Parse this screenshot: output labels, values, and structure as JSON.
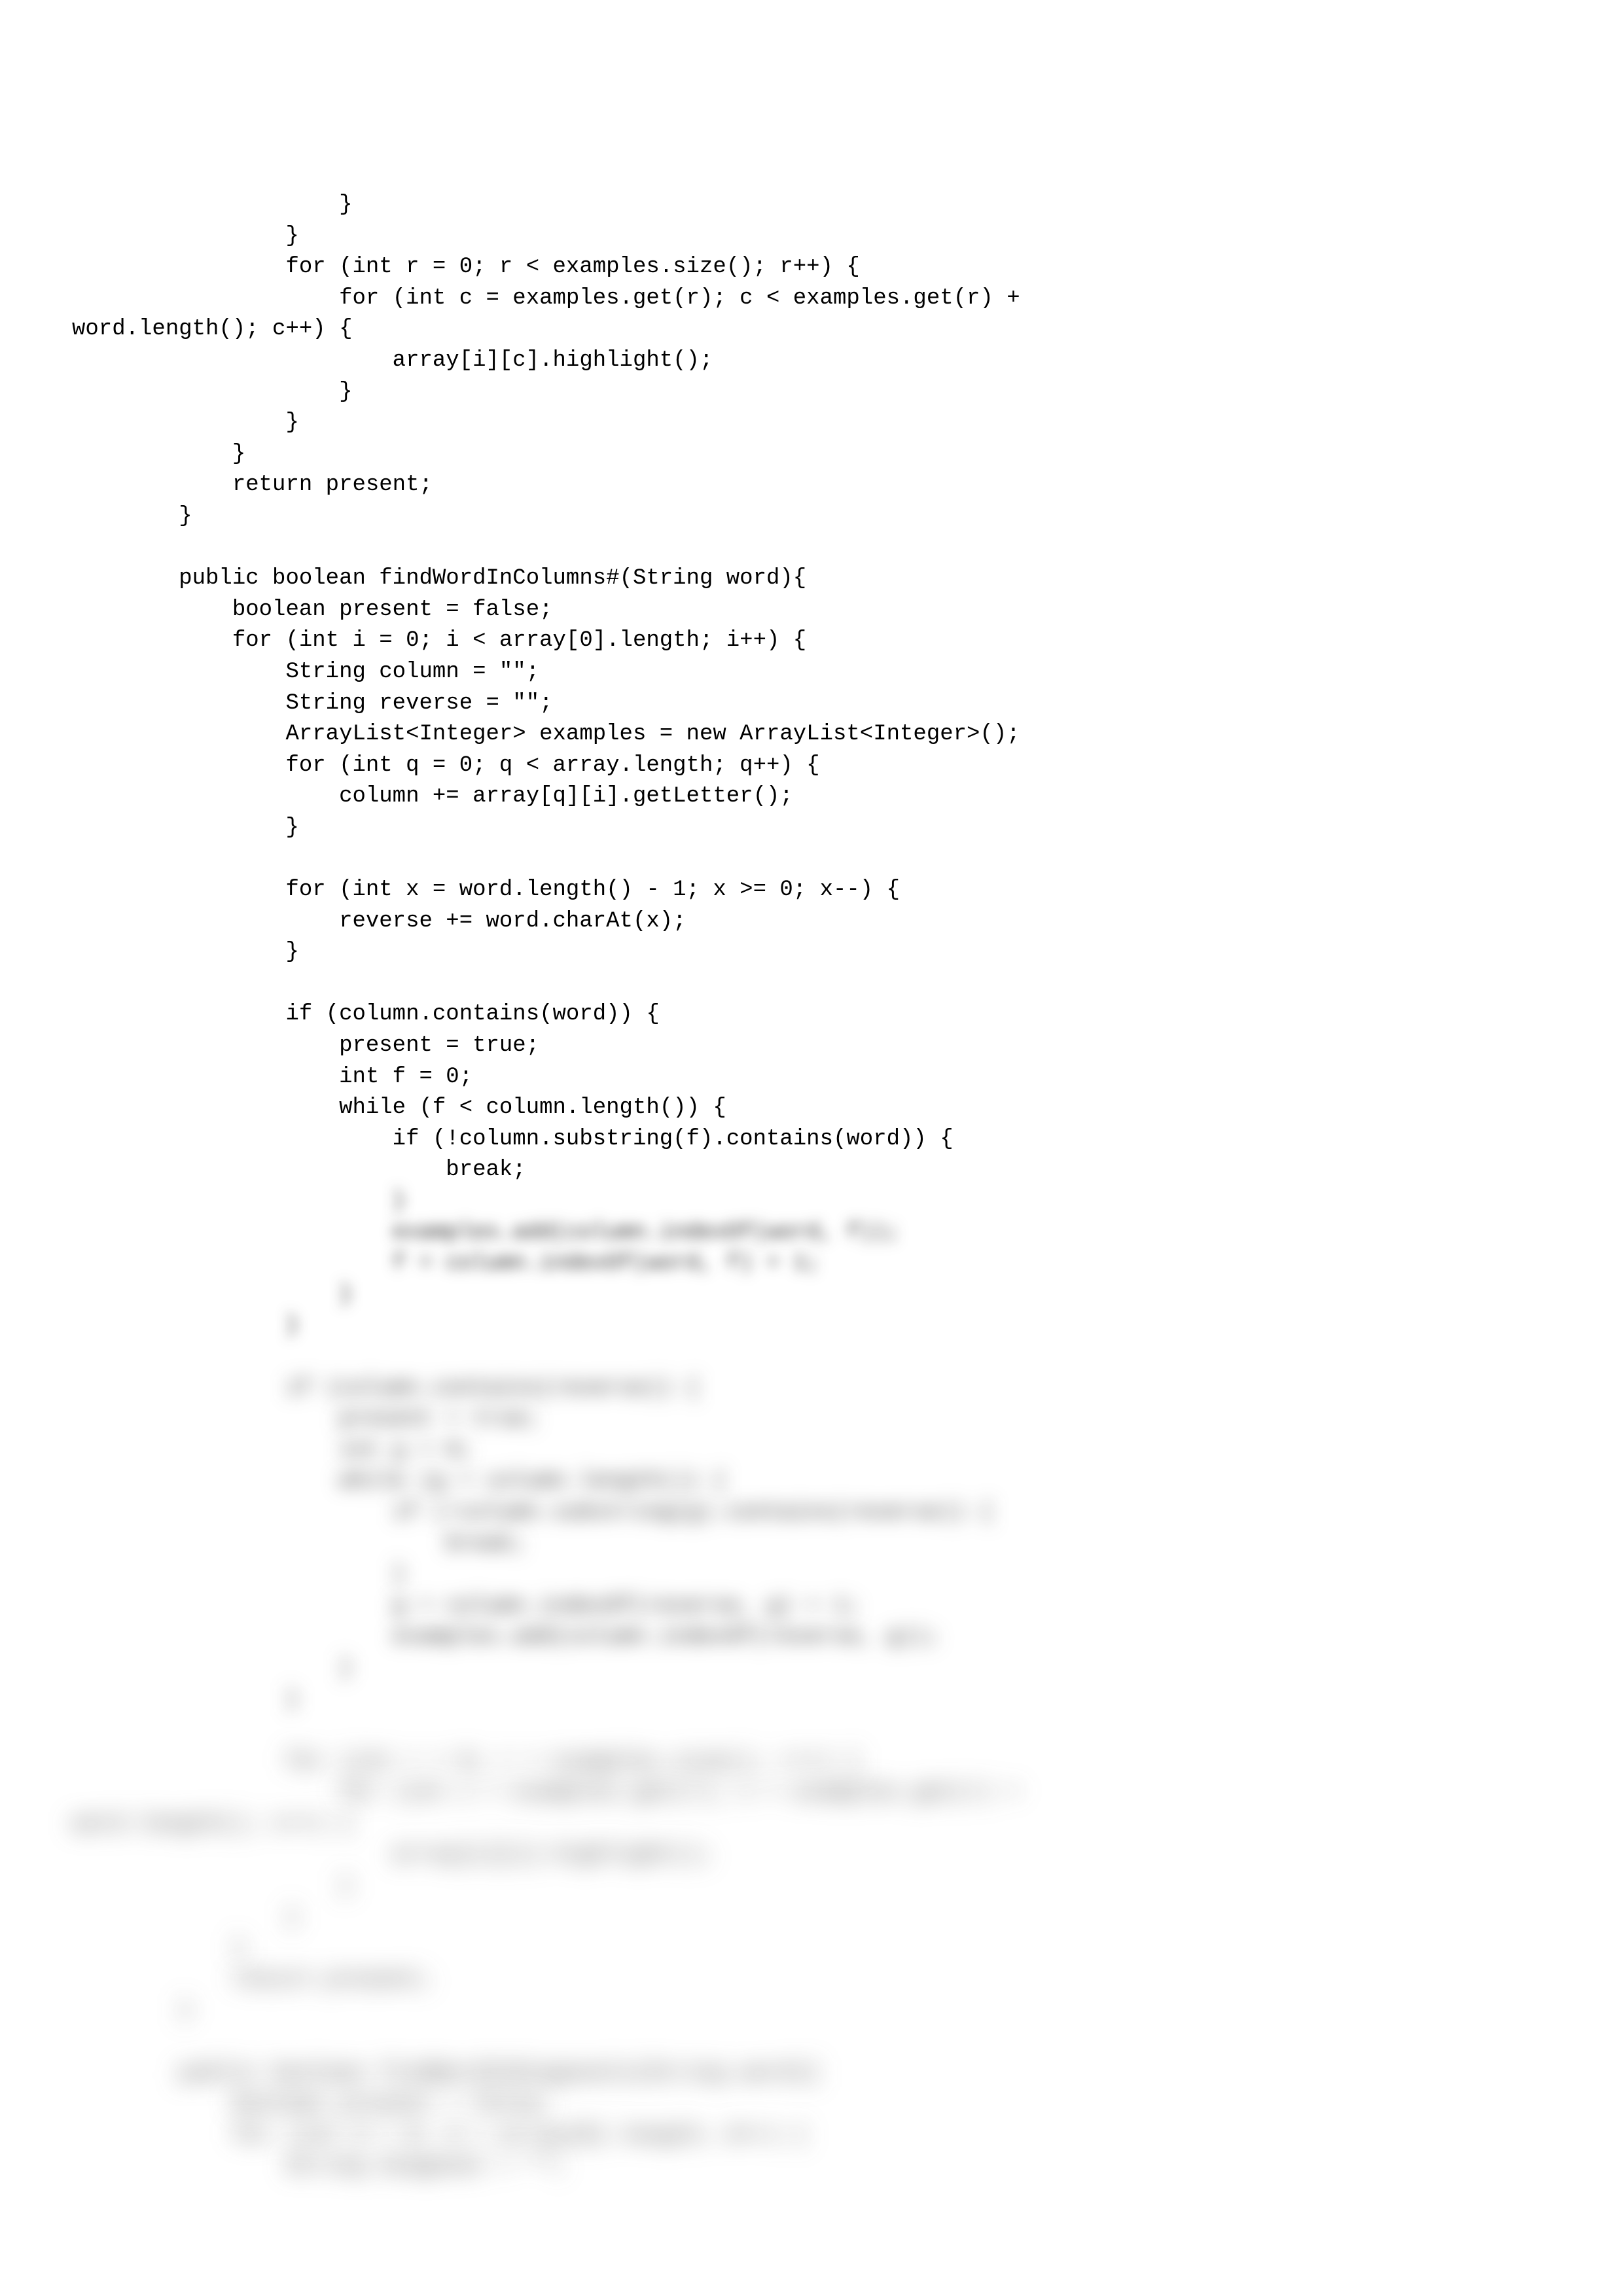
{
  "lines": [
    {
      "text": "                    }",
      "cls": ""
    },
    {
      "text": "                }",
      "cls": ""
    },
    {
      "text": "                for (int r = 0; r < examples.size(); r++) {",
      "cls": ""
    },
    {
      "text": "                    for (int c = examples.get(r); c < examples.get(r) +",
      "cls": ""
    },
    {
      "text": "word.length(); c++) {",
      "cls": ""
    },
    {
      "text": "                        array[i][c].highlight();",
      "cls": ""
    },
    {
      "text": "                    }",
      "cls": ""
    },
    {
      "text": "                }",
      "cls": ""
    },
    {
      "text": "            }",
      "cls": ""
    },
    {
      "text": "            return present;",
      "cls": ""
    },
    {
      "text": "        }",
      "cls": ""
    },
    {
      "text": "",
      "cls": ""
    },
    {
      "text": "        public boolean findWordInColumns#(String word){",
      "cls": ""
    },
    {
      "text": "            boolean present = false;",
      "cls": ""
    },
    {
      "text": "            for (int i = 0; i < array[0].length; i++) {",
      "cls": ""
    },
    {
      "text": "                String column = \"\";",
      "cls": ""
    },
    {
      "text": "                String reverse = \"\";",
      "cls": ""
    },
    {
      "text": "                ArrayList<Integer> examples = new ArrayList<Integer>();",
      "cls": ""
    },
    {
      "text": "                for (int q = 0; q < array.length; q++) {",
      "cls": ""
    },
    {
      "text": "                    column += array[q][i].getLetter();",
      "cls": ""
    },
    {
      "text": "                }",
      "cls": ""
    },
    {
      "text": "",
      "cls": ""
    },
    {
      "text": "                for (int x = word.length() - 1; x >= 0; x--) {",
      "cls": ""
    },
    {
      "text": "                    reverse += word.charAt(x);",
      "cls": ""
    },
    {
      "text": "                }",
      "cls": ""
    },
    {
      "text": "",
      "cls": ""
    },
    {
      "text": "                if (column.contains(word)) {",
      "cls": ""
    },
    {
      "text": "                    present = true;",
      "cls": ""
    },
    {
      "text": "                    int f = 0;",
      "cls": ""
    },
    {
      "text": "                    while (f < column.length()) {",
      "cls": ""
    },
    {
      "text": "                        if (!column.substring(f).contains(word)) {",
      "cls": ""
    },
    {
      "text": "                            break;",
      "cls": ""
    },
    {
      "text": "                        }",
      "cls": "blur-start"
    },
    {
      "text": "                        examples.add(column.indexOf(word, f));",
      "cls": "blur-start"
    },
    {
      "text": "                        f = column.indexOf(word, f) + 1;",
      "cls": "blur-start"
    },
    {
      "text": "                    }",
      "cls": "blur-start"
    },
    {
      "text": "                }",
      "cls": "blur-start"
    },
    {
      "text": "",
      "cls": "blur-start"
    },
    {
      "text": "                if (column.contains(reverse)) {",
      "cls": "blur-mid"
    },
    {
      "text": "                    present = true;",
      "cls": "blur-mid"
    },
    {
      "text": "                    int g = 0;",
      "cls": "blur-mid"
    },
    {
      "text": "                    while (g < column.length()) {",
      "cls": "blur-mid"
    },
    {
      "text": "                        if (!column.substring(g).contains(reverse)) {",
      "cls": "blur-mid"
    },
    {
      "text": "                            break;",
      "cls": "blur-mid"
    },
    {
      "text": "                        }",
      "cls": "blur-mid"
    },
    {
      "text": "                        g = column.indexOf(reverse, g) + 1;",
      "cls": "blur-mid"
    },
    {
      "text": "                        examples.add(column.indexOf(reverse, g));",
      "cls": "blur-mid"
    },
    {
      "text": "                    }",
      "cls": "blur-mid"
    },
    {
      "text": "                }",
      "cls": "blur-mid"
    },
    {
      "text": "",
      "cls": "blur-mid"
    },
    {
      "text": "                for (int r = 0; r < examples.size(); r++) {",
      "cls": "blur-heavy"
    },
    {
      "text": "                    for (int c = examples.get(r); c < examples.get(r) +",
      "cls": "blur-heavy"
    },
    {
      "text": "word.length(); c++) {",
      "cls": "blur-heavy"
    },
    {
      "text": "                        array[c][i].highlight();",
      "cls": "blur-heavy"
    },
    {
      "text": "                    }",
      "cls": "blur-heavy"
    },
    {
      "text": "                }",
      "cls": "blur-heavy"
    },
    {
      "text": "            }",
      "cls": "blur-heavy"
    },
    {
      "text": "            return present;",
      "cls": "blur-heavy"
    },
    {
      "text": "        }",
      "cls": "blur-heavy"
    },
    {
      "text": "",
      "cls": "blur-heavy"
    },
    {
      "text": "        public boolean findWordInDiagonals(String word){",
      "cls": "blur-heavy"
    },
    {
      "text": "            boolean present = false;",
      "cls": "blur-heavy"
    },
    {
      "text": "            for (int d = 0; d < array[0].length; d++) {",
      "cls": "blur-heavy"
    },
    {
      "text": "                String diagonal = \"\";",
      "cls": "blur-heavy"
    }
  ]
}
